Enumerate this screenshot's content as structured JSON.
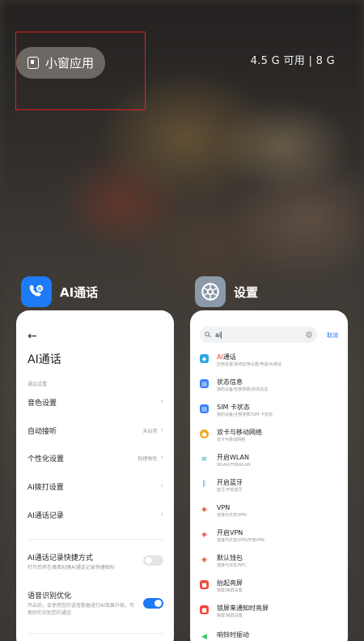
{
  "top": {
    "small_window_label": "小窗应用",
    "memory_text": "4.5 G 可用 | 8 G"
  },
  "apps": [
    {
      "name": "AI通话",
      "icon": "ai-call-icon",
      "color": "#1d7bf5"
    },
    {
      "name": "设置",
      "icon": "settings-gear-icon",
      "color": "#8a9aa8"
    }
  ],
  "ai_call": {
    "title": "AI通话",
    "section": "通话设置",
    "rows": [
      {
        "label": "音色设置",
        "value": ""
      },
      {
        "label": "自动接听",
        "value": "未启用"
      },
      {
        "label": "个性化设置",
        "value": "助理角色"
      },
      {
        "label": "AI拨打设置",
        "value": ""
      },
      {
        "label": "AI通话记录",
        "value": ""
      }
    ],
    "toggles": [
      {
        "label": "AI通话记录快捷方式",
        "sub": "打开后将在桌面创建AI通话记录快捷图标",
        "on": false
      },
      {
        "label": "语音识别优化",
        "sub": "开启后，会使用您的语音数据进行AI效果升级，可更好的识别您的通话",
        "on": true
      }
    ]
  },
  "settings": {
    "search_query": "ai",
    "cancel_label": "取消",
    "results": [
      {
        "hl": "AI",
        "rest": "通话",
        "sub": "应用设置/系统应用设置/电话/AI通话",
        "icon": "ai-icon",
        "color": "#2fa6e8"
      },
      {
        "hl": "",
        "rest": "状态信息",
        "sub": "我的设备/全部参数/状态信息",
        "icon": "info-icon",
        "color": "#3b82f6"
      },
      {
        "hl": "",
        "rest": "SIM 卡状态",
        "sub": "我的设备/全部参数/SIM 卡状态",
        "icon": "info-icon",
        "color": "#3b82f6"
      },
      {
        "hl": "",
        "rest": "双卡与移动网络",
        "sub": "双卡与移动网络",
        "icon": "sim-icon",
        "color": "#f5a623"
      },
      {
        "hl": "",
        "rest": "开启WLAN",
        "sub": "WLAN/开启WLAN",
        "icon": "wifi-icon",
        "color": "#1fb3a4"
      },
      {
        "hl": "",
        "rest": "开启蓝牙",
        "sub": "蓝牙/开启蓝牙",
        "icon": "bluetooth-icon",
        "color": "#2f80ed"
      },
      {
        "hl": "",
        "rest": "VPN",
        "sub": "连接与共享/VPN",
        "icon": "vpn-icon",
        "color": "#e8452c"
      },
      {
        "hl": "",
        "rest": "开启VPN",
        "sub": "连接与共享/VPN/开启VPN",
        "icon": "vpn-icon",
        "color": "#e8452c"
      },
      {
        "hl": "",
        "rest": "默认钱包",
        "sub": "连接与共享/NFC",
        "icon": "nfc-icon",
        "color": "#e8452c"
      },
      {
        "hl": "",
        "rest": "抬起亮屏",
        "sub": "锁屏/锁屏设置",
        "icon": "lock-icon",
        "color": "#f0443a"
      },
      {
        "hl": "",
        "rest": "锁屏来通知时亮屏",
        "sub": "锁屏/锁屏设置",
        "icon": "lock-icon",
        "color": "#f0443a"
      },
      {
        "hl": "",
        "rest": "响铃时振动",
        "sub": "",
        "icon": "sound-icon",
        "color": "#3ac36a"
      }
    ]
  }
}
